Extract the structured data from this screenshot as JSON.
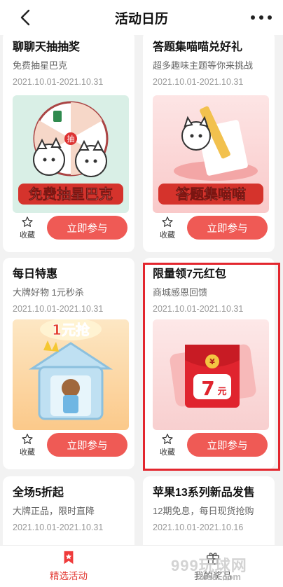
{
  "header": {
    "title": "活动日历",
    "back_icon": "chevron-left-icon",
    "more_icon": "more-dots-icon"
  },
  "cards": [
    {
      "title": "聊聊天抽抽奖",
      "subtitle": "免费抽星巴克",
      "date": "2021.10.01-2021.10.31",
      "banner_caption": "免费抽星巴克",
      "wheel_label": "抽",
      "fav_label": "收藏",
      "join_label": "立即参与"
    },
    {
      "title": "答题集喵喵兑好礼",
      "subtitle": "超多趣味主题等你来挑战",
      "date": "2021.10.01-2021.10.31",
      "banner_caption": "答题集喵喵",
      "fav_label": "收藏",
      "join_label": "立即参与"
    },
    {
      "title": "每日特惠",
      "subtitle": "大牌好物 1元秒杀",
      "date": "2021.10.01-2021.10.31",
      "banner_caption": "1元抢",
      "fav_label": "收藏",
      "join_label": "立即参与"
    },
    {
      "title": "限量领7元红包",
      "subtitle": "商城感恩回馈",
      "date": "2021.10.01-2021.10.31",
      "envelope_amount": "7",
      "envelope_unit": "元",
      "envelope_symbol": "¥",
      "fav_label": "收藏",
      "join_label": "立即参与"
    },
    {
      "title": "全场5折起",
      "subtitle": "大牌正品，限时直降",
      "date": "2021.10.01-2021.10.31"
    },
    {
      "title": "苹果13系列新品发售",
      "subtitle": "12期免息，每日现货抢购",
      "date": "2021.10.01-2021.10.16"
    }
  ],
  "tabs": [
    {
      "label": "精选活动",
      "active": true
    },
    {
      "label": "我的奖品",
      "active": false
    }
  ],
  "watermark": {
    "text": "999玩球网",
    "sub": "bisai.com"
  },
  "colors": {
    "accent": "#ef5a55",
    "highlight": "#e3262e",
    "page_bg": "#f2f2f2"
  }
}
